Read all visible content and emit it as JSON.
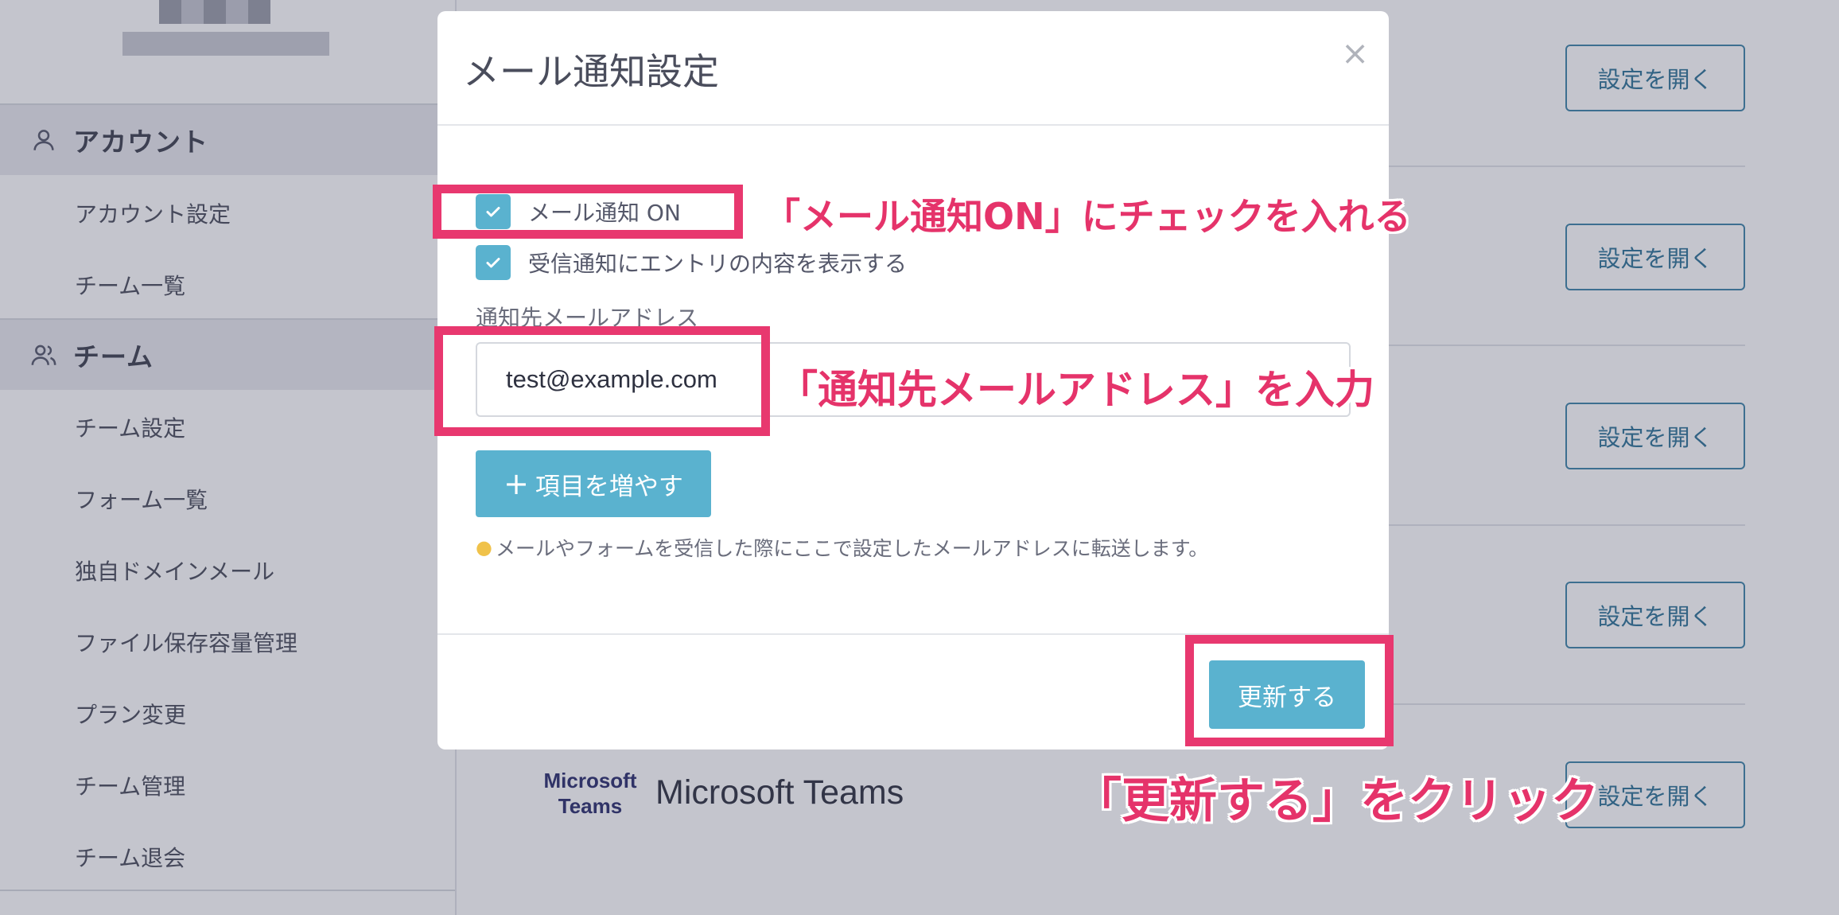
{
  "sidebar": {
    "sections": [
      {
        "label": "アカウント",
        "icon": "user-icon",
        "items": [
          "アカウント設定",
          "チーム一覧"
        ]
      },
      {
        "label": "チーム",
        "icon": "users-icon",
        "items": [
          "チーム設定",
          "フォーム一覧",
          "独自ドメインメール",
          "ファイル保存容量管理",
          "プラン変更",
          "チーム管理",
          "チーム退会"
        ]
      }
    ]
  },
  "main": {
    "open_button_label": "設定を開く",
    "integration": {
      "logo_text": "Microsoft Teams",
      "title": "Microsoft Teams"
    }
  },
  "modal": {
    "title": "メール通知設定",
    "close_symbol": "×",
    "checkbox_mail_on": {
      "label": "メール通知 ON",
      "checked": true
    },
    "checkbox_show_entry": {
      "label": "受信通知にエントリの内容を表示する",
      "checked": true
    },
    "email_field_label": "通知先メールアドレス",
    "email_value": "test@example.com",
    "add_item_label": "項目を増やす",
    "hint": "メールやフォームを受信した際にここで設定したメールアドレスに転送します。",
    "update_label": "更新する"
  },
  "annotations": {
    "check": "「メール通知ON」にチェックを入れる",
    "email": "「通知先メールアドレス」を入力",
    "update": "「更新する」をクリック",
    "color": "#e8386f"
  },
  "colors": {
    "accent": "#5ab2cf",
    "outline_button": "#2f7397",
    "highlight": "#e8386f"
  }
}
